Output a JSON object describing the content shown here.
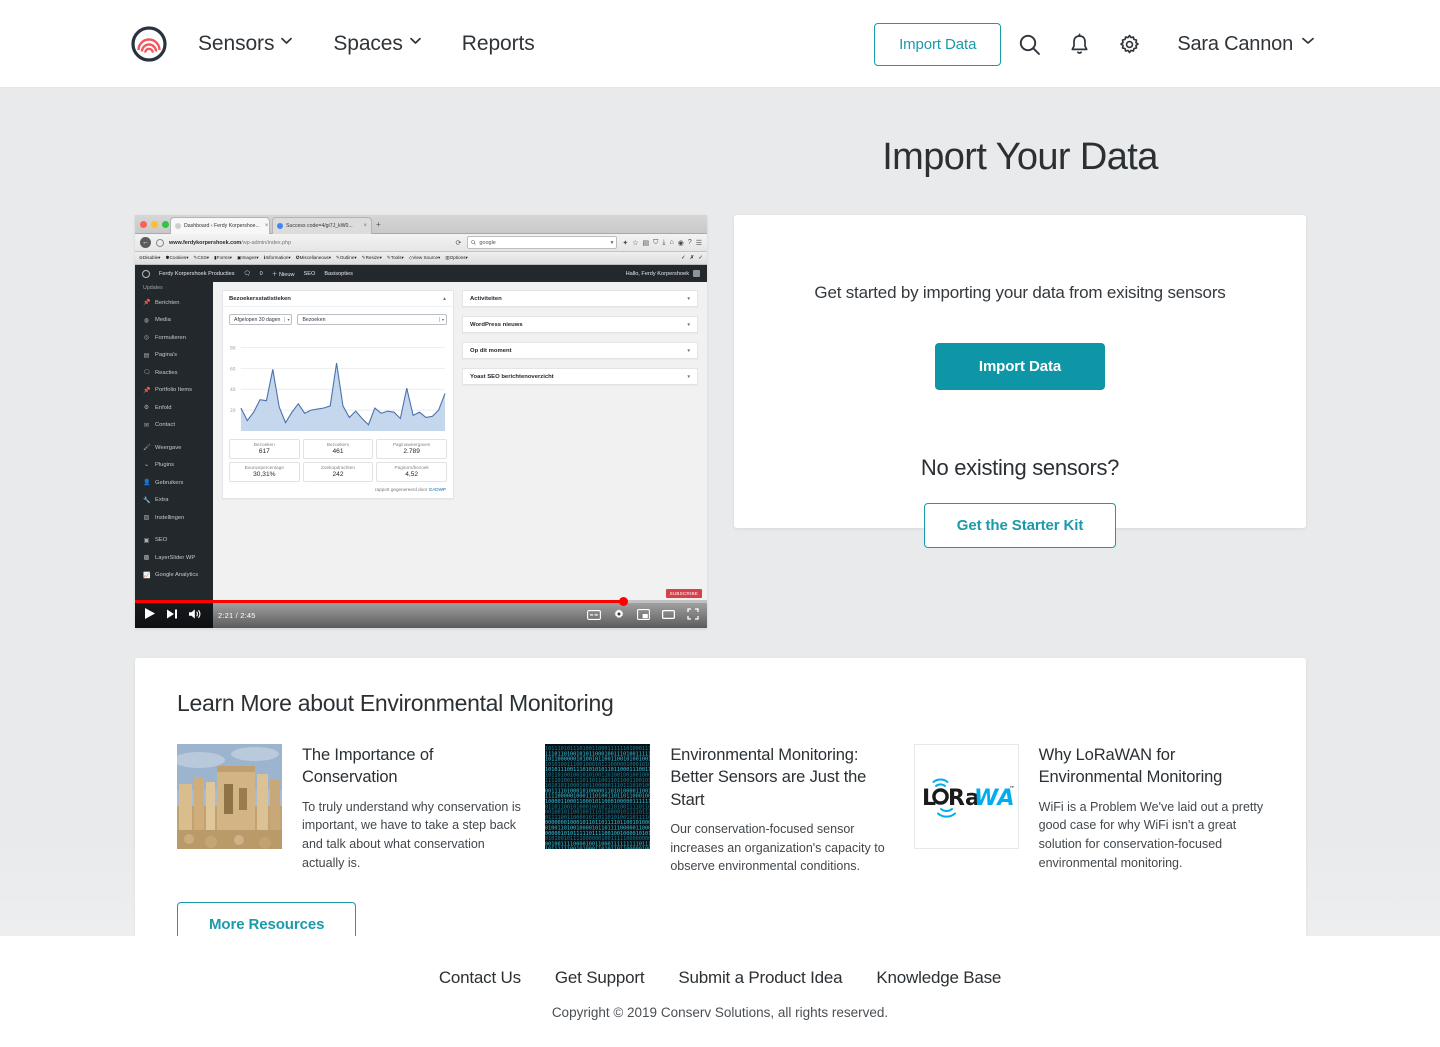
{
  "header": {
    "logo_name": "conserv-logo",
    "nav": [
      {
        "label": "Sensors",
        "has_dropdown": true
      },
      {
        "label": "Spaces",
        "has_dropdown": true
      },
      {
        "label": "Reports",
        "has_dropdown": false
      }
    ],
    "import_button": "Import Data",
    "icons": [
      "search-icon",
      "bell-icon",
      "gear-icon"
    ],
    "user": "Sara Cannon"
  },
  "main": {
    "title": "Import Your Data",
    "import_card": {
      "subtitle": "Get started by importing your data from exisitng sensors",
      "import_button": "Import Data",
      "no_sensors_heading": "No existing sensors?",
      "starter_kit_button": "Get the Starter Kit"
    }
  },
  "video": {
    "browser": {
      "tabs": [
        {
          "title": "Dashboard ‹ Ferdy Korpershoe...",
          "close": "×"
        },
        {
          "title": "Success code=4/gi7J_kW0...",
          "close": "×"
        }
      ],
      "new_tab": "+",
      "url_prefix": "www.ferdykorpershoek.com",
      "url_suffix": "/wp-admin/index.php",
      "search_placeholder": "google",
      "reload": "⟳",
      "ext_toolbar": [
        "Disable",
        "Cookies",
        "CSS",
        "Forms",
        "Images",
        "Information",
        "Miscellaneous",
        "Outline",
        "Resize",
        "Tools",
        "View Source",
        "Options"
      ]
    },
    "wp": {
      "adminbar": {
        "site": "Ferdy Korpershoek Producties",
        "comments": "0",
        "new": "Nieuw",
        "seo": "SEO",
        "basis": "Basisopties",
        "greeting": "Hallo, Ferdy Korpershoek"
      },
      "sidebar_top": "Updates",
      "sidebar": [
        "Berichten",
        "Media",
        "Formulieren",
        "Pagina's",
        "Reacties",
        "Portfolio Items",
        "Enfold",
        "Contact",
        "Weergave",
        "Plugins",
        "Gebruikers",
        "Extra",
        "Instellingen",
        "SEO",
        "LayerSlider WP",
        "Google Analytics"
      ],
      "panel_title": "Bezoekersstatistieken",
      "select_range": "Afgelopen 30 dagen",
      "select_metric": "Bezoeken",
      "stats": [
        {
          "label": "Bezoeken",
          "value": "617"
        },
        {
          "label": "Bezoekers",
          "value": "461"
        },
        {
          "label": "Paginaweergaven",
          "value": "2.789"
        },
        {
          "label": "Bouncepercentage",
          "value": "30,31%"
        },
        {
          "label": "Zoekopdrachten",
          "value": "242"
        },
        {
          "label": "Pagina's/bezoek",
          "value": "4,52"
        }
      ],
      "panel_footer": "rapport gegenereerd door",
      "panel_footer_link": "GADWP",
      "widgets": [
        "Activiteiten",
        "WordPress nieuws",
        "Op dit moment",
        "Yoast SEO berichtenoverzicht"
      ]
    },
    "player": {
      "time": "2:21 / 2:45",
      "progress_percent": 85,
      "subscribe": "SUBSCRIBE"
    },
    "chart_data": {
      "type": "area",
      "title": "Bezoekersstatistieken",
      "xlabel": "",
      "ylabel": "",
      "ylim": [
        0,
        90
      ],
      "yticks": [
        20,
        40,
        60,
        80
      ],
      "grid": true,
      "legend": "none",
      "series": [
        {
          "name": "Bezoeken",
          "values": [
            22,
            10,
            18,
            30,
            29,
            59,
            23,
            8,
            18,
            26,
            17,
            20,
            21,
            22,
            24,
            65,
            24,
            13,
            19,
            12,
            6,
            22,
            17,
            19,
            18,
            12,
            41,
            15,
            18,
            13,
            14,
            20,
            36
          ]
        }
      ]
    }
  },
  "learn": {
    "title": "Learn More about Environmental Monitoring",
    "resources": [
      {
        "thumb": "ruins-photo",
        "heading": "The Importance of Conservation",
        "body": "To truly understand why conservation is important, we have to take a step back and talk about what conservation actually is."
      },
      {
        "thumb": "binary-code-image",
        "heading": "Environmental Monitoring: Better Sensors are Just the Start",
        "body": "Our conservation-focused sensor increases an organization's capacity to observe environmental conditions."
      },
      {
        "thumb": "lorawan-logo",
        "heading": "Why LoRaWAN for Environmental Monitoring",
        "body": "WiFi is a Problem We've laid out a pretty good case for why WiFi isn't a great solution for conservation-focused environmental monitoring."
      }
    ],
    "more_button": "More Resources"
  },
  "footer": {
    "links": [
      "Contact Us",
      "Get Support",
      "Submit a Product Idea",
      "Knowledge Base"
    ],
    "copyright": "Copyright © 2019 Conserv Solutions, all rights reserved."
  },
  "colors": {
    "accent_teal": "#1b9aaa",
    "accent_teal_solid": "#0e96a6",
    "logo_navy": "#29333f",
    "logo_coral": "#f2575f",
    "text_dark": "#2b3034",
    "page_bg": "#e8eaeb",
    "lorawan_cyan": "#00aeef"
  }
}
